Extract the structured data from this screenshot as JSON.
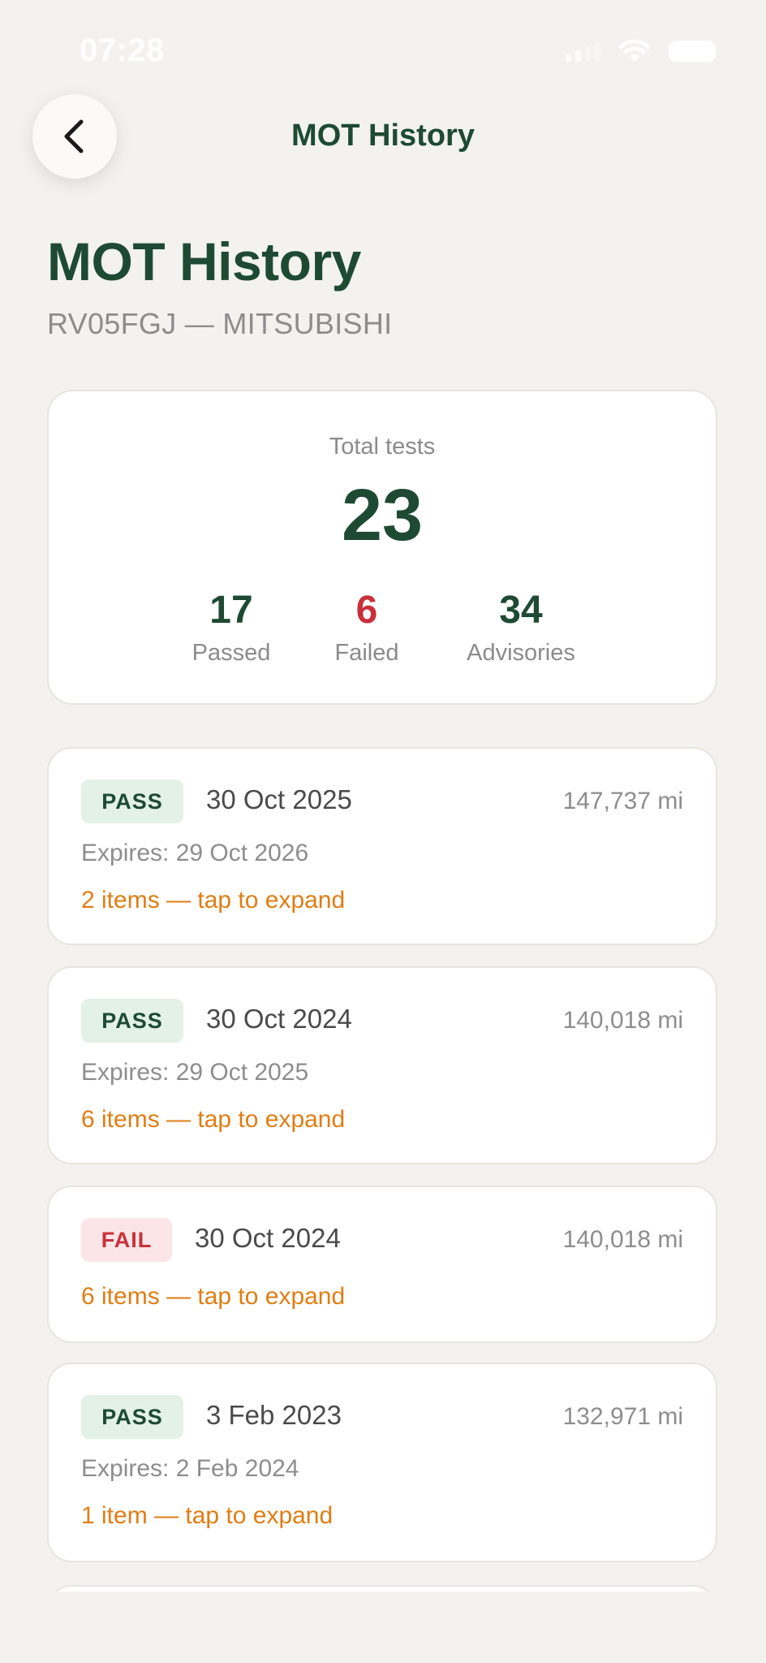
{
  "status_bar": {
    "time": "07:28"
  },
  "nav": {
    "title": "MOT History"
  },
  "header": {
    "title": "MOT History",
    "subtitle": "RV05FGJ — MITSUBISHI"
  },
  "summary": {
    "total_label": "Total tests",
    "total_value": "23",
    "passed_value": "17",
    "passed_label": "Passed",
    "failed_value": "6",
    "failed_label": "Failed",
    "advisories_value": "34",
    "advisories_label": "Advisories"
  },
  "tests": [
    {
      "result": "PASS",
      "date": "30 Oct 2025",
      "mileage": "147,737 mi",
      "expires": "Expires: 29 Oct 2026",
      "expand": "2 items — tap to expand"
    },
    {
      "result": "PASS",
      "date": "30 Oct 2024",
      "mileage": "140,018 mi",
      "expires": "Expires: 29 Oct 2025",
      "expand": "6 items — tap to expand"
    },
    {
      "result": "FAIL",
      "date": "30 Oct 2024",
      "mileage": "140,018 mi",
      "expand": "6 items — tap to expand"
    },
    {
      "result": "PASS",
      "date": "3 Feb 2023",
      "mileage": "132,971 mi",
      "expires": "Expires: 2 Feb 2024",
      "expand": "1 item — tap to expand"
    }
  ],
  "colors": {
    "brand_green": "#1e4a33",
    "fail_red": "#c9303a",
    "expand_orange": "#e07d14",
    "background": "#f3f2ef"
  },
  "icons": {
    "back": "chevron-left-icon",
    "signal": "signal-icon",
    "wifi": "wifi-icon",
    "battery": "battery-icon"
  }
}
